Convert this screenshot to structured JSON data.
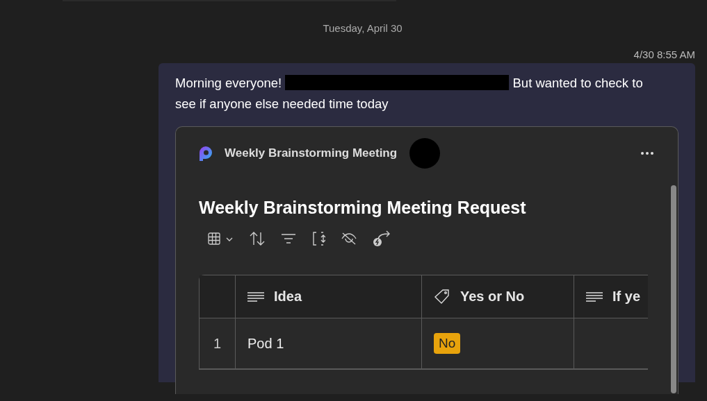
{
  "date_divider": "Tuesday, April 30",
  "message": {
    "timestamp": "4/30 8:55 AM",
    "text_before": "Morning everyone!",
    "redacted": true,
    "text_after": "But wanted to check to",
    "text_continued": "see if anyone else needed time today",
    "card": {
      "app_name": "Weekly Brainstorming Meeting",
      "title": "Weekly Brainstorming Meeting Request",
      "columns": [
        {
          "kind": "index"
        },
        {
          "label": "Idea",
          "kind": "text"
        },
        {
          "label": "Yes or No",
          "kind": "choice"
        },
        {
          "label": "If ye",
          "kind": "text"
        }
      ],
      "rows": [
        {
          "cells": [
            "1",
            "Pod 1",
            {
              "tag": "No",
              "color": "#e8a30c"
            },
            ""
          ]
        }
      ]
    }
  }
}
